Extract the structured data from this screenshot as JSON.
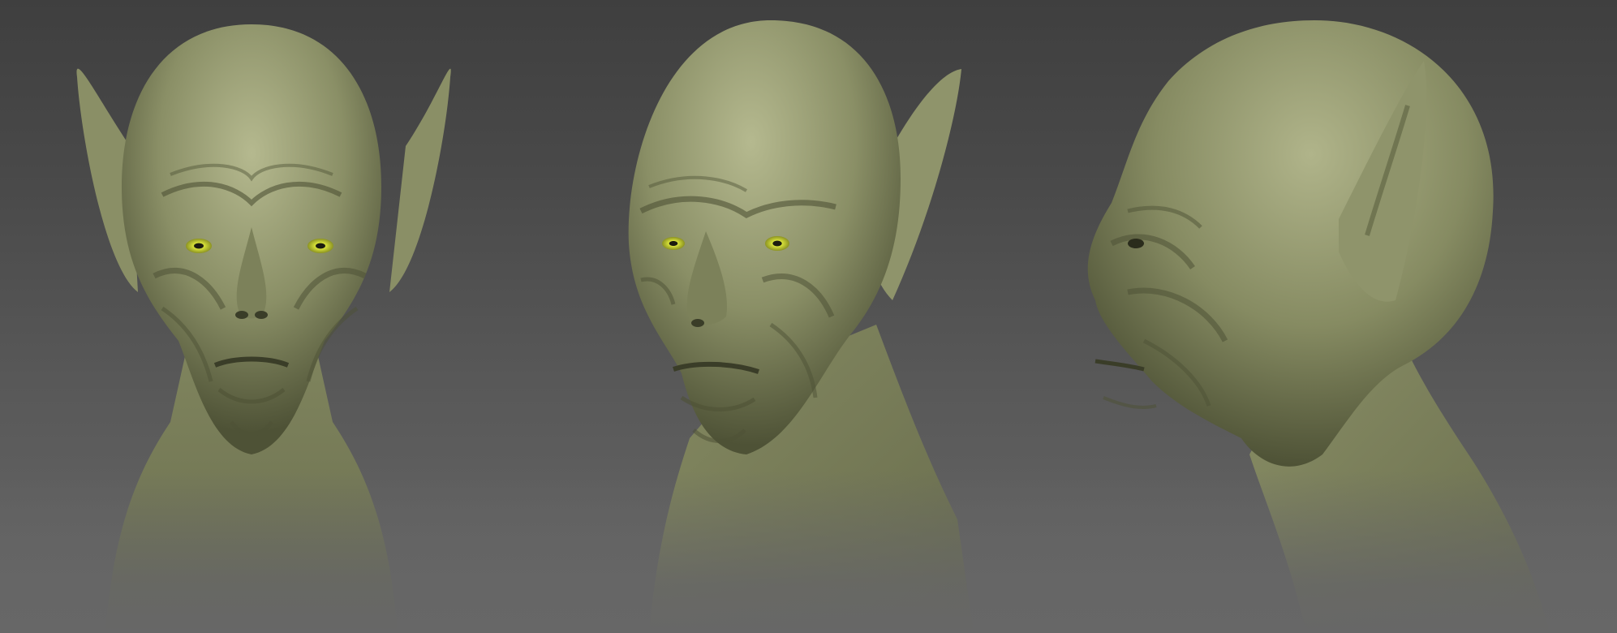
{
  "scene": {
    "subject": "",
    "views": [
      {
        "id": "front"
      },
      {
        "id": "three-quarter"
      },
      {
        "id": "profile"
      }
    ]
  },
  "colors": {
    "background_top": "#3f3f3f",
    "background_bottom": "#676767",
    "skin_light": "#b5b98f",
    "skin_mid": "#8a8f66",
    "skin_dark": "#4e5236",
    "eye_iris": "#d8e23a",
    "eye_pupil": "#1c1c10"
  }
}
